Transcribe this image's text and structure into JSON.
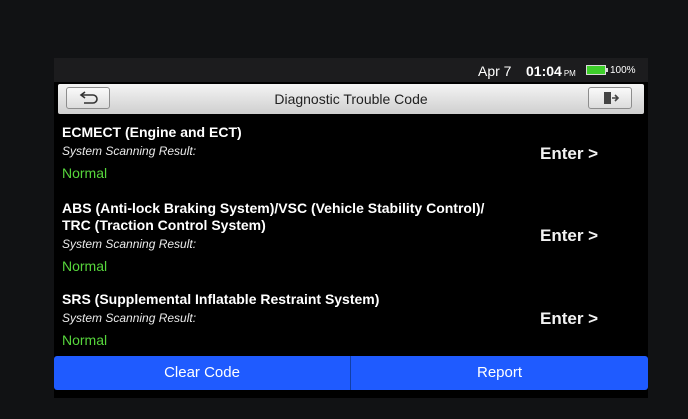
{
  "status_bar": {
    "date": "Apr 7",
    "time": "01:04",
    "ampm": "PM",
    "battery_percent": "100%"
  },
  "header": {
    "title": "Diagnostic Trouble Code",
    "back_icon": "back-arrow-icon",
    "exit_icon": "exit-door-icon"
  },
  "systems": [
    {
      "name": "ECMECT (Engine and ECT)",
      "label": "System Scanning Result:",
      "result": "Normal",
      "action": "Enter >"
    },
    {
      "name": "ABS (Anti-lock Braking System)/VSC (Vehicle Stability Control)/ TRC (Traction Control System)",
      "label": "System Scanning Result:",
      "result": "Normal",
      "action": "Enter >"
    },
    {
      "name": "SRS (Supplemental Inflatable Restraint System)",
      "label": "System Scanning Result:",
      "result": "Normal",
      "action": "Enter >"
    }
  ],
  "footer": {
    "clear_label": "Clear Code",
    "report_label": "Report"
  },
  "colors": {
    "accent_blue": "#1f5bff",
    "normal_green": "#57d63c",
    "battery_green": "#3ecf2b"
  }
}
